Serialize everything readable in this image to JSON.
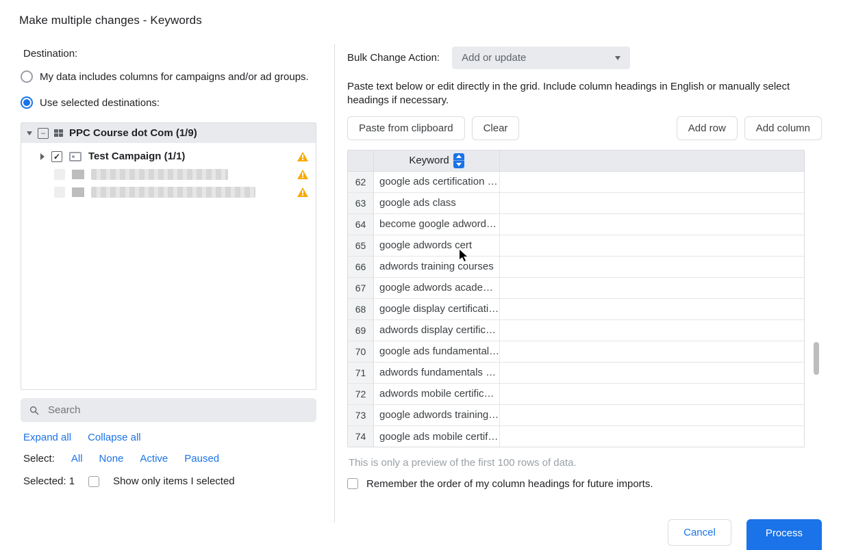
{
  "dialog": {
    "title": "Make multiple changes - Keywords"
  },
  "left": {
    "header": "Destination:",
    "radio_columns": "My data includes columns for campaigns and/or ad groups.",
    "radio_selected": "Use selected destinations:",
    "tree_root": "PPC Course dot Com (1/9)",
    "tree_item1": "Test Campaign (1/1)",
    "search_placeholder": "Search",
    "expand_all": "Expand all",
    "collapse_all": "Collapse all",
    "select_label": "Select:",
    "select_all": "All",
    "select_none": "None",
    "select_active": "Active",
    "select_paused": "Paused",
    "selected_text": "Selected: 1",
    "show_only": "Show only items I selected"
  },
  "right": {
    "bca_label": "Bulk Change Action:",
    "bca_value": "Add or update",
    "instruction": "Paste text below or edit directly in the grid. Include column headings in English or manually select headings if necessary.",
    "paste": "Paste from clipboard",
    "clear": "Clear",
    "add_row": "Add row",
    "add_column": "Add column",
    "col_header": "Keyword",
    "rows": [
      {
        "n": "62",
        "v": "google ads certification …"
      },
      {
        "n": "63",
        "v": "google ads class"
      },
      {
        "n": "64",
        "v": "become google adword…"
      },
      {
        "n": "65",
        "v": "google adwords cert"
      },
      {
        "n": "66",
        "v": "adwords training courses"
      },
      {
        "n": "67",
        "v": "google adwords acade…"
      },
      {
        "n": "68",
        "v": "google display certificati…"
      },
      {
        "n": "69",
        "v": "adwords display certific…"
      },
      {
        "n": "70",
        "v": "google ads fundamental…"
      },
      {
        "n": "71",
        "v": "adwords fundamentals …"
      },
      {
        "n": "72",
        "v": "adwords mobile certific…"
      },
      {
        "n": "73",
        "v": "google adwords training…"
      },
      {
        "n": "74",
        "v": "google ads mobile certif…"
      }
    ],
    "preview_note": "This is only a preview of the first 100 rows of data.",
    "remember": "Remember the order of my column headings for future imports."
  },
  "footer": {
    "cancel": "Cancel",
    "process": "Process"
  }
}
